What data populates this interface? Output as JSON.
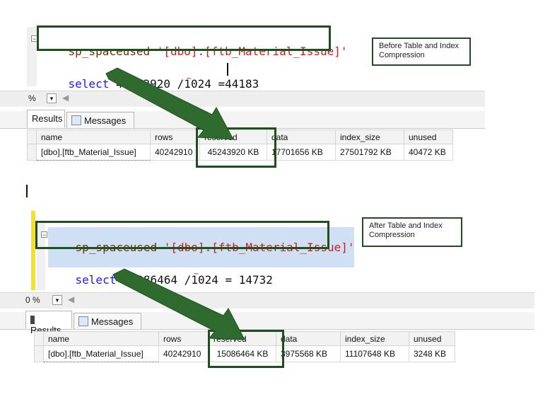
{
  "before": {
    "query": {
      "fn": "sp_spaceused",
      "arg": "'[dbo].[ftb_Material_Issue]'"
    },
    "calc": {
      "keyword": "select",
      "value": "45243920",
      "op": "/1024",
      "eq": "=",
      "result": "44183"
    },
    "note": "Before Table and Index Compression",
    "zoom": "%",
    "tabs": {
      "results": "Results",
      "messages": "Messages"
    },
    "columns": [
      "name",
      "rows",
      "reserved",
      "data",
      "index_size",
      "unused"
    ],
    "row": [
      "[dbo].[ftb_Material_Issue]",
      "40242910",
      "45243920 KB",
      "17701656 KB",
      "27501792 KB",
      "40472 KB"
    ]
  },
  "after": {
    "query": {
      "fn": "sp_spaceused",
      "arg": "'[dbo].[ftb_Material_Issue]'"
    },
    "calc": {
      "keyword": "select",
      "value": "15086464",
      "op": "/1024",
      "eq": "=",
      "result": "14732"
    },
    "note": "After Table and Index Compression",
    "zoom": "0 %",
    "tabs": {
      "results": "Results",
      "messages": "Messages"
    },
    "columns": [
      "name",
      "rows",
      "reserved",
      "data",
      "index_size",
      "unused"
    ],
    "row": [
      "[dbo].[ftb_Material_Issue]",
      "40242910",
      "15086464 KB",
      "3975568 KB",
      "11107648 KB",
      "3248 KB"
    ]
  },
  "colors": {
    "annotation": "#1f4f1f",
    "arrow": "#2f6b2f",
    "keyword": "#1a1aff",
    "string": "#d11a1a"
  },
  "icons": {
    "tab_results": "grid-icon",
    "tab_messages": "messages-icon",
    "collapse": "collapse-minus-icon"
  }
}
